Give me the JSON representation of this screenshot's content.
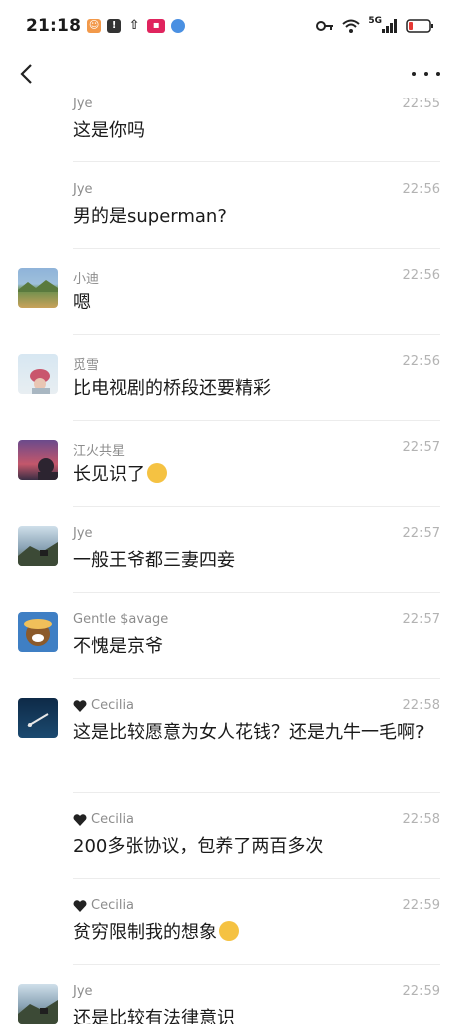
{
  "status": {
    "time": "21:18",
    "network": "5G"
  },
  "messages": [
    {
      "name": "Jye",
      "time": "22:55",
      "text": "这是你吗",
      "avatar": "none"
    },
    {
      "name": "Jye",
      "time": "22:56",
      "text": "男的是superman?",
      "avatar": "none"
    },
    {
      "name": "小迪",
      "time": "22:56",
      "text": "嗯",
      "avatar": "landscape"
    },
    {
      "name": "觅雪",
      "time": "22:56",
      "text": "比电视剧的桥段还要精彩",
      "avatar": "person-hat"
    },
    {
      "name": "江火共星",
      "time": "22:57",
      "text": "长见识了",
      "avatar": "sunset"
    },
    {
      "name": "Jye",
      "time": "22:57",
      "text": "一般王爷都三妻四妾",
      "avatar": "mountain"
    },
    {
      "name": "Gentle $avage",
      "time": "22:57",
      "text": "不愧是京爷",
      "avatar": "cartoon"
    },
    {
      "name": "Cecilia",
      "time": "22:58",
      "text": "这是比较愿意为女人花钱？还是九牛一毛啊?",
      "avatar": "diver"
    },
    {
      "name": "Cecilia",
      "time": "22:58",
      "text": "200多张协议，包养了两百多次",
      "avatar": "none"
    },
    {
      "name": "Cecilia",
      "time": "22:59",
      "text": "贫穷限制我的想象",
      "avatar": "none"
    },
    {
      "name": "Jye",
      "time": "22:59",
      "text": "还是比较有法律意识",
      "avatar": "mountain"
    }
  ]
}
